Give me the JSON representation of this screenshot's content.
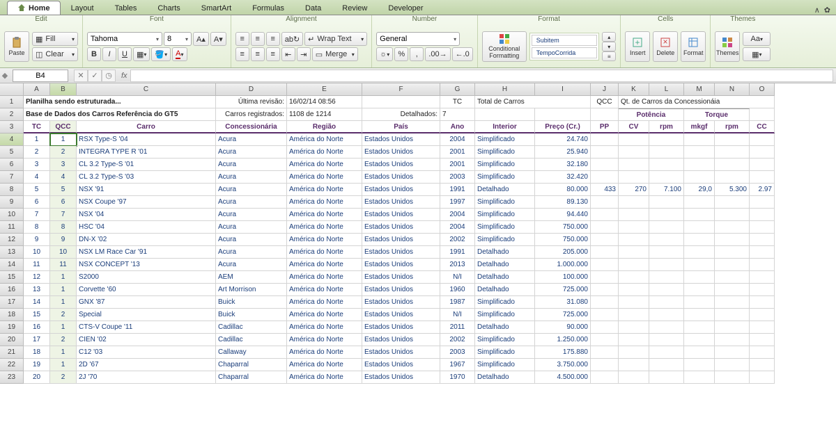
{
  "tabs": [
    "Home",
    "Layout",
    "Tables",
    "Charts",
    "SmartArt",
    "Formulas",
    "Data",
    "Review",
    "Developer"
  ],
  "ribbon": {
    "groups": {
      "edit": {
        "title": "Edit",
        "paste": "Paste",
        "fill": "Fill",
        "clear": "Clear"
      },
      "font": {
        "title": "Font",
        "name": "Tahoma",
        "size": "8"
      },
      "alignment": {
        "title": "Alignment",
        "wrap": "Wrap Text",
        "merge": "Merge"
      },
      "number": {
        "title": "Number",
        "format": "General"
      },
      "format": {
        "title": "Format",
        "conditional": "Conditional Formatting",
        "style1": "Subitem",
        "style2": "TempoCorrida"
      },
      "cells": {
        "title": "Cells",
        "insert": "Insert",
        "delete": "Delete",
        "format_btn": "Format"
      },
      "themes": {
        "title": "Themes",
        "themes_btn": "Themes",
        "aa": "Aa"
      }
    }
  },
  "namebox": "B4",
  "columns": [
    "A",
    "B",
    "C",
    "D",
    "E",
    "F",
    "G",
    "H",
    "I",
    "J",
    "K",
    "L",
    "M",
    "N",
    "O"
  ],
  "row1": {
    "title": "Planilha sendo estruturada...",
    "last_rev_label": "Última revisão:",
    "last_rev_value": "16/02/14 08:56",
    "tc_label": "TC",
    "tc_desc": "Total de Carros",
    "qcc_label": "QCC",
    "qcc_desc": "Qt. de Carros da Concessionáia"
  },
  "row2": {
    "title": "Base de Dados dos Carros Referência do GT5",
    "reg_label": "Carros registrados:",
    "reg_value": "1108 de 1214",
    "det_label": "Detalhados:",
    "det_value": "7",
    "potencia": "Potência",
    "torque": "Torque"
  },
  "headers": {
    "tc": "TC",
    "qcc": "QCC",
    "carro": "Carro",
    "conc": "Concessionária",
    "regiao": "Região",
    "pais": "País",
    "ano": "Ano",
    "interior": "Interior",
    "preco": "Preço (Cr.)",
    "pp": "PP",
    "cv": "CV",
    "rpm": "rpm",
    "mkgf": "mkgf",
    "rpm2": "rpm",
    "cc": "CC"
  },
  "rows": [
    {
      "tc": "1",
      "qcc": "1",
      "carro": "RSX Type-S '04",
      "conc": "Acura",
      "regiao": "América do Norte",
      "pais": "Estados Unidos",
      "ano": "2004",
      "interior": "Simplificado",
      "preco": "24.740"
    },
    {
      "tc": "2",
      "qcc": "2",
      "carro": "INTEGRA TYPE R '01",
      "conc": "Acura",
      "regiao": "América do Norte",
      "pais": "Estados Unidos",
      "ano": "2001",
      "interior": "Simplificado",
      "preco": "25.940"
    },
    {
      "tc": "3",
      "qcc": "3",
      "carro": "CL 3.2 Type-S '01",
      "conc": "Acura",
      "regiao": "América do Norte",
      "pais": "Estados Unidos",
      "ano": "2001",
      "interior": "Simplificado",
      "preco": "32.180"
    },
    {
      "tc": "4",
      "qcc": "4",
      "carro": "CL 3.2 Type-S '03",
      "conc": "Acura",
      "regiao": "América do Norte",
      "pais": "Estados Unidos",
      "ano": "2003",
      "interior": "Simplificado",
      "preco": "32.420"
    },
    {
      "tc": "5",
      "qcc": "5",
      "carro": "NSX '91",
      "conc": "Acura",
      "regiao": "América do Norte",
      "pais": "Estados Unidos",
      "ano": "1991",
      "interior": "Detalhado",
      "preco": "80.000",
      "pp": "433",
      "cv": "270",
      "rpm": "7.100",
      "mkgf": "29,0",
      "rpm2": "5.300",
      "cc": "2.97"
    },
    {
      "tc": "6",
      "qcc": "6",
      "carro": "NSX Coupe '97",
      "conc": "Acura",
      "regiao": "América do Norte",
      "pais": "Estados Unidos",
      "ano": "1997",
      "interior": "Simplificado",
      "preco": "89.130"
    },
    {
      "tc": "7",
      "qcc": "7",
      "carro": "NSX '04",
      "conc": "Acura",
      "regiao": "América do Norte",
      "pais": "Estados Unidos",
      "ano": "2004",
      "interior": "Simplificado",
      "preco": "94.440"
    },
    {
      "tc": "8",
      "qcc": "8",
      "carro": "HSC '04",
      "conc": "Acura",
      "regiao": "América do Norte",
      "pais": "Estados Unidos",
      "ano": "2004",
      "interior": "Simplificado",
      "preco": "750.000"
    },
    {
      "tc": "9",
      "qcc": "9",
      "carro": "DN-X '02",
      "conc": "Acura",
      "regiao": "América do Norte",
      "pais": "Estados Unidos",
      "ano": "2002",
      "interior": "Simplificado",
      "preco": "750.000"
    },
    {
      "tc": "10",
      "qcc": "10",
      "carro": "NSX LM Race Car '91",
      "conc": "Acura",
      "regiao": "América do Norte",
      "pais": "Estados Unidos",
      "ano": "1991",
      "interior": "Detalhado",
      "preco": "205.000"
    },
    {
      "tc": "11",
      "qcc": "11",
      "carro": "NSX CONCEPT '13",
      "conc": "Acura",
      "regiao": "América do Norte",
      "pais": "Estados Unidos",
      "ano": "2013",
      "interior": "Detalhado",
      "preco": "1.000.000"
    },
    {
      "tc": "12",
      "qcc": "1",
      "carro": "S2000",
      "conc": "AEM",
      "regiao": "América do Norte",
      "pais": "Estados Unidos",
      "ano": "N/I",
      "interior": "Detalhado",
      "preco": "100.000"
    },
    {
      "tc": "13",
      "qcc": "1",
      "carro": "Corvette '60",
      "conc": "Art Morrison",
      "regiao": "América do Norte",
      "pais": "Estados Unidos",
      "ano": "1960",
      "interior": "Detalhado",
      "preco": "725.000"
    },
    {
      "tc": "14",
      "qcc": "1",
      "carro": "GNX '87",
      "conc": "Buick",
      "regiao": "América do Norte",
      "pais": "Estados Unidos",
      "ano": "1987",
      "interior": "Simplificado",
      "preco": "31.080"
    },
    {
      "tc": "15",
      "qcc": "2",
      "carro": "Special",
      "conc": "Buick",
      "regiao": "América do Norte",
      "pais": "Estados Unidos",
      "ano": "N/I",
      "interior": "Simplificado",
      "preco": "725.000"
    },
    {
      "tc": "16",
      "qcc": "1",
      "carro": "CTS-V Coupe '11",
      "conc": "Cadillac",
      "regiao": "América do Norte",
      "pais": "Estados Unidos",
      "ano": "2011",
      "interior": "Detalhado",
      "preco": "90.000"
    },
    {
      "tc": "17",
      "qcc": "2",
      "carro": "CIEN '02",
      "conc": "Cadillac",
      "regiao": "América do Norte",
      "pais": "Estados Unidos",
      "ano": "2002",
      "interior": "Simplificado",
      "preco": "1.250.000"
    },
    {
      "tc": "18",
      "qcc": "1",
      "carro": "C12 '03",
      "conc": "Callaway",
      "regiao": "América do Norte",
      "pais": "Estados Unidos",
      "ano": "2003",
      "interior": "Simplificado",
      "preco": "175.880"
    },
    {
      "tc": "19",
      "qcc": "1",
      "carro": "2D '67",
      "conc": "Chaparral",
      "regiao": "América do Norte",
      "pais": "Estados Unidos",
      "ano": "1967",
      "interior": "Simplificado",
      "preco": "3.750.000"
    },
    {
      "tc": "20",
      "qcc": "2",
      "carro": "2J '70",
      "conc": "Chaparral",
      "regiao": "América do Norte",
      "pais": "Estados Unidos",
      "ano": "1970",
      "interior": "Detalhado",
      "preco": "4.500.000"
    }
  ]
}
